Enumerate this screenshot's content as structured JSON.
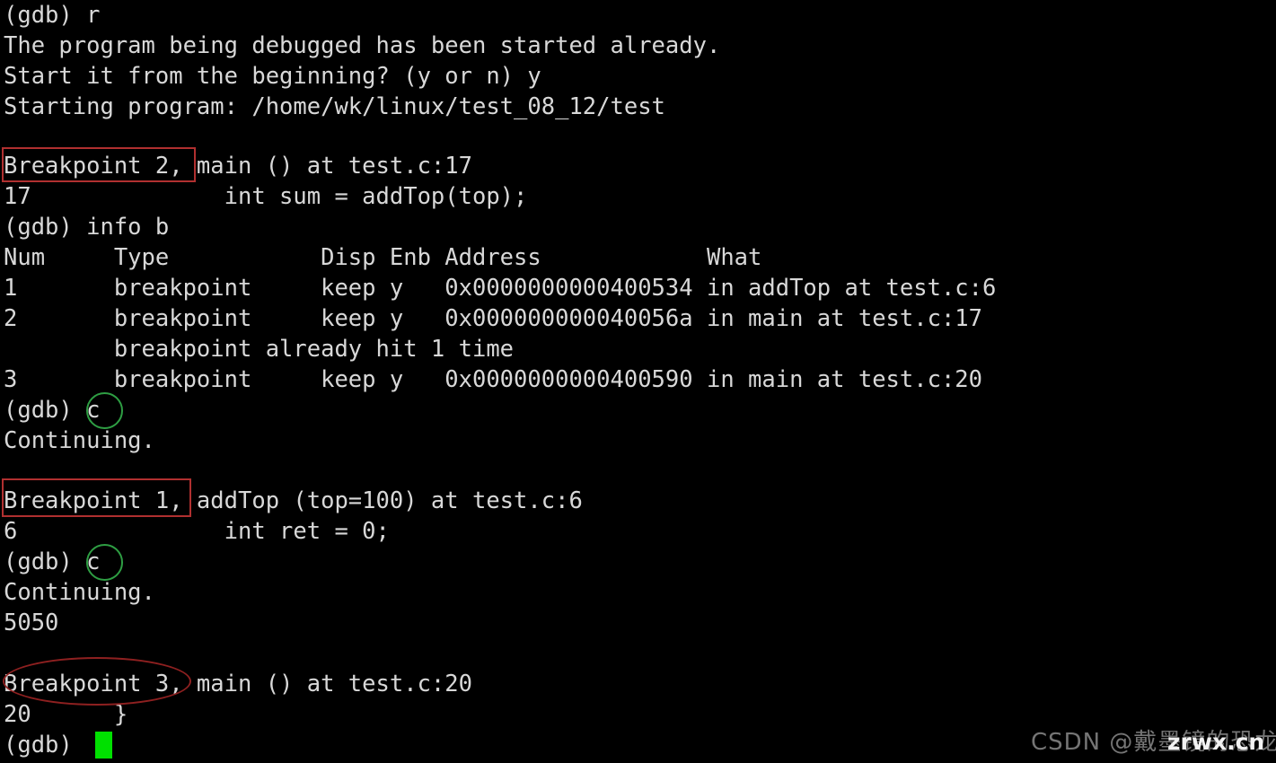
{
  "terminal": {
    "background_color": "#000000",
    "foreground_color": "#d8d8d8",
    "cursor_color": "#00e000",
    "lines": [
      {
        "text": "(gdb) r"
      },
      {
        "text": "The program being debugged has been started already."
      },
      {
        "text": "Start it from the beginning? (y or n) y"
      },
      {
        "text": "Starting program: /home/wk/linux/test_08_12/test"
      },
      {
        "text": ""
      },
      {
        "text": "Breakpoint 2, main () at test.c:17"
      },
      {
        "text": "17              int sum = addTop(top);"
      },
      {
        "text": "(gdb) info b"
      },
      {
        "text": "Num     Type           Disp Enb Address            What"
      },
      {
        "text": "1       breakpoint     keep y   0x0000000000400534 in addTop at test.c:6"
      },
      {
        "text": "2       breakpoint     keep y   0x000000000040056a in main at test.c:17"
      },
      {
        "text": "        breakpoint already hit 1 time"
      },
      {
        "text": "3       breakpoint     keep y   0x0000000000400590 in main at test.c:20"
      },
      {
        "text": "(gdb) c"
      },
      {
        "text": "Continuing."
      },
      {
        "text": ""
      },
      {
        "text": "Breakpoint 1, addTop (top=100) at test.c:6"
      },
      {
        "text": "6               int ret = 0;"
      },
      {
        "text": "(gdb) c"
      },
      {
        "text": "Continuing."
      },
      {
        "text": "5050"
      },
      {
        "text": ""
      },
      {
        "text": ""
      },
      {
        "text": "Breakpoint 3, main () at test.c:20"
      },
      {
        "text": "20      }"
      },
      {
        "text": "(gdb) "
      }
    ]
  },
  "breakpoint_table": {
    "headers": [
      "Num",
      "Type",
      "Disp",
      "Enb",
      "Address",
      "What"
    ],
    "rows": [
      {
        "num": "1",
        "type": "breakpoint",
        "disp": "keep",
        "enb": "y",
        "address": "0x0000000000400534",
        "what": "in addTop at test.c:6"
      },
      {
        "num": "2",
        "type": "breakpoint",
        "disp": "keep",
        "enb": "y",
        "address": "0x000000000040056a",
        "what": "in main at test.c:17",
        "note": "breakpoint already hit 1 time"
      },
      {
        "num": "3",
        "type": "breakpoint",
        "disp": "keep",
        "enb": "y",
        "address": "0x0000000000400590",
        "what": "in main at test.c:20"
      }
    ]
  },
  "annotations": {
    "rect_breakpoint_2": {
      "label": "Breakpoint 2",
      "color": "#b03030"
    },
    "rect_breakpoint_1": {
      "label": "Breakpoint 1",
      "color": "#b03030"
    },
    "ellipse_breakpoint_3": {
      "label": "Breakpoint 3",
      "color": "#8e2020"
    },
    "circle_continue_1": {
      "label": "c",
      "color": "#2e9e43"
    },
    "circle_continue_2": {
      "label": "c",
      "color": "#2e9e43"
    }
  },
  "watermark": {
    "csdn_text": "CSDN @戴墨镜的恐龙",
    "overlay_text": "zrwx.cn"
  }
}
